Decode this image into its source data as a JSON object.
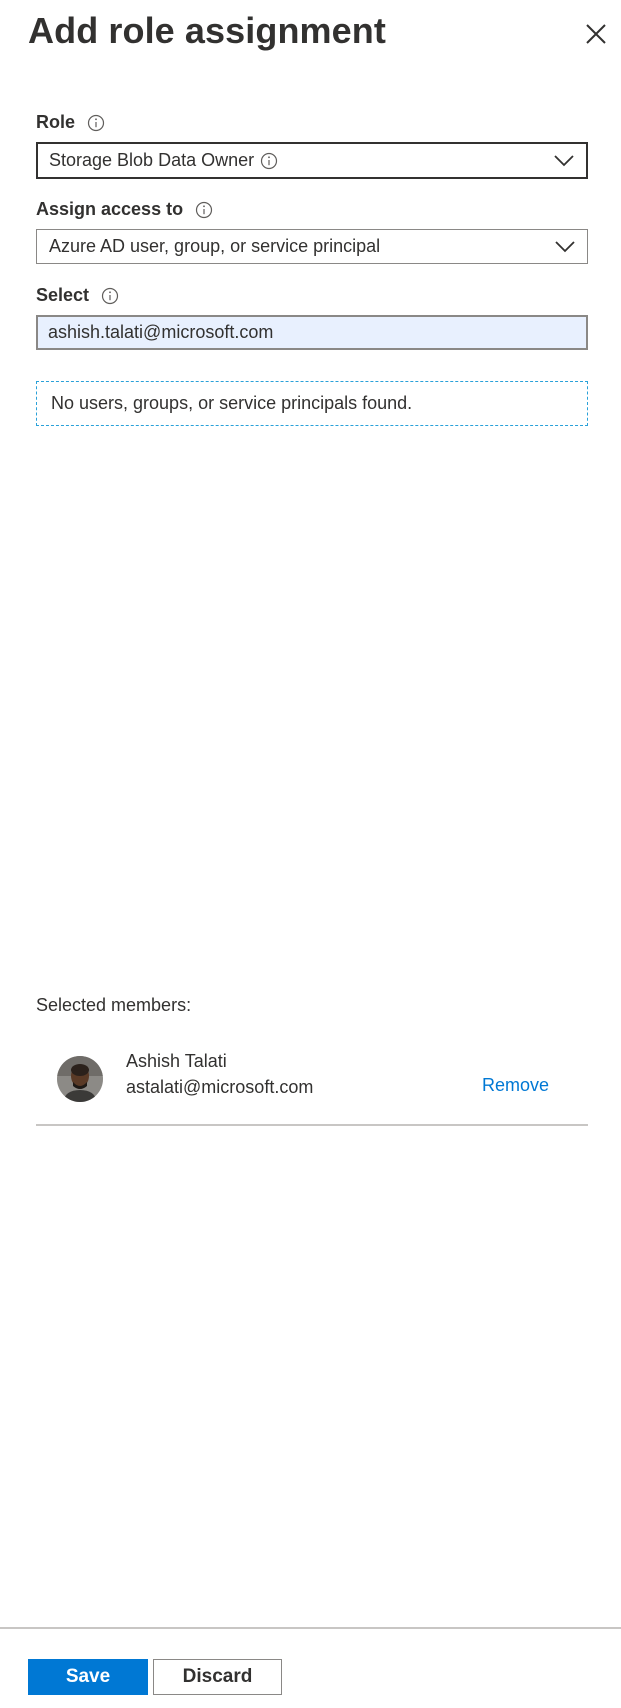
{
  "panel": {
    "title": "Add role assignment",
    "close_icon": "close-icon"
  },
  "role": {
    "label": "Role",
    "info_icon": "info-icon",
    "value": "Storage Blob Data Owner",
    "value_info_icon": "info-icon",
    "dropdown_icon": "chevron-down-icon"
  },
  "assign_access": {
    "label": "Assign access to",
    "info_icon": "info-icon",
    "value": "Azure AD user, group, or service principal",
    "dropdown_icon": "chevron-down-icon"
  },
  "select": {
    "label": "Select",
    "info_icon": "info-icon",
    "value": "ashish.talati@microsoft.com",
    "no_results": "No users, groups, or service principals found."
  },
  "selected_members": {
    "label": "Selected members:",
    "members": [
      {
        "name": "Ashish Talati",
        "email": "astalati@microsoft.com",
        "remove_label": "Remove"
      }
    ]
  },
  "footer": {
    "save_label": "Save",
    "discard_label": "Discard"
  },
  "colors": {
    "accent": "#0078d4",
    "input_fill": "#e8f0fe",
    "dashed_border": "#2aa1d9",
    "text": "#323130"
  }
}
